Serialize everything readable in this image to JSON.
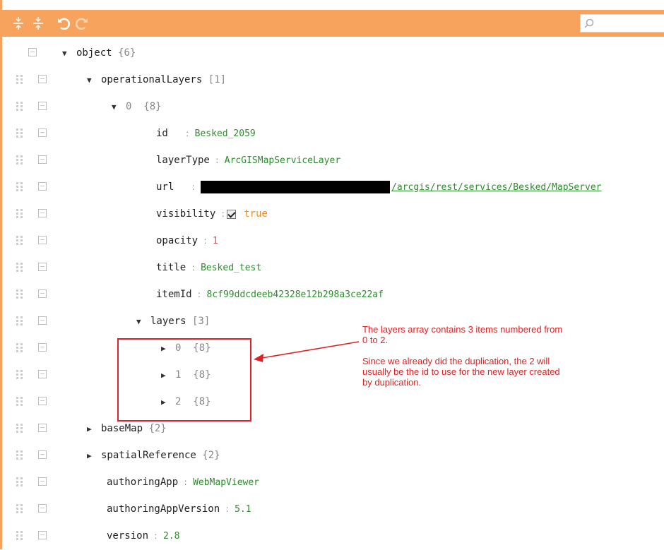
{
  "toolbar": {
    "buttons": [
      {
        "name": "expand-all-icon"
      },
      {
        "name": "collapse-all-icon"
      },
      {
        "name": "undo-icon"
      },
      {
        "name": "redo-icon"
      }
    ],
    "search_placeholder": "",
    "search_icon": "search-icon"
  },
  "tree": {
    "root": {
      "label": "object",
      "count": "{6}"
    },
    "operationalLayers": {
      "label": "operationalLayers",
      "count": "[1]"
    },
    "item0": {
      "label": "0",
      "count": "{8}"
    },
    "id": {
      "key": "id",
      "value": "Besked_2059"
    },
    "layerType": {
      "key": "layerType",
      "value": "ArcGISMapServiceLayer"
    },
    "url": {
      "key": "url",
      "value": "/arcgis/rest/services/Besked/MapServer"
    },
    "visibility": {
      "key": "visibility",
      "value": "true"
    },
    "opacity": {
      "key": "opacity",
      "value": "1"
    },
    "title": {
      "key": "title",
      "value": "Besked_test"
    },
    "itemId": {
      "key": "itemId",
      "value": "8cf99ddcdeeb42328e12b298a3ce22af"
    },
    "layers": {
      "label": "layers",
      "count": "[3]"
    },
    "layer_items": [
      {
        "index": "0",
        "count": "{8}"
      },
      {
        "index": "1",
        "count": "{8}"
      },
      {
        "index": "2",
        "count": "{8}"
      }
    ],
    "baseMap": {
      "label": "baseMap",
      "count": "{2}"
    },
    "spatialReference": {
      "label": "spatialReference",
      "count": "{2}"
    },
    "authoringApp": {
      "key": "authoringApp",
      "value": "WebMapViewer"
    },
    "authoringAppVersion": {
      "key": "authoringAppVersion",
      "value": "5.1"
    },
    "version": {
      "key": "version",
      "value": "2.8"
    }
  },
  "annotation": {
    "line1": "The layers array contains 3 items numbered from",
    "line2": "0 to 2.",
    "line3": "Since we already did the duplication, the 2 will",
    "line4": "usually be the id to use for the new layer created",
    "line5": "by duplication."
  },
  "colors": {
    "toolbar": "#f7a25d",
    "string_value": "#2e8b2e",
    "number_value": "#e05050",
    "boolean_value": "#f08a24",
    "annotation": "#e02020"
  }
}
